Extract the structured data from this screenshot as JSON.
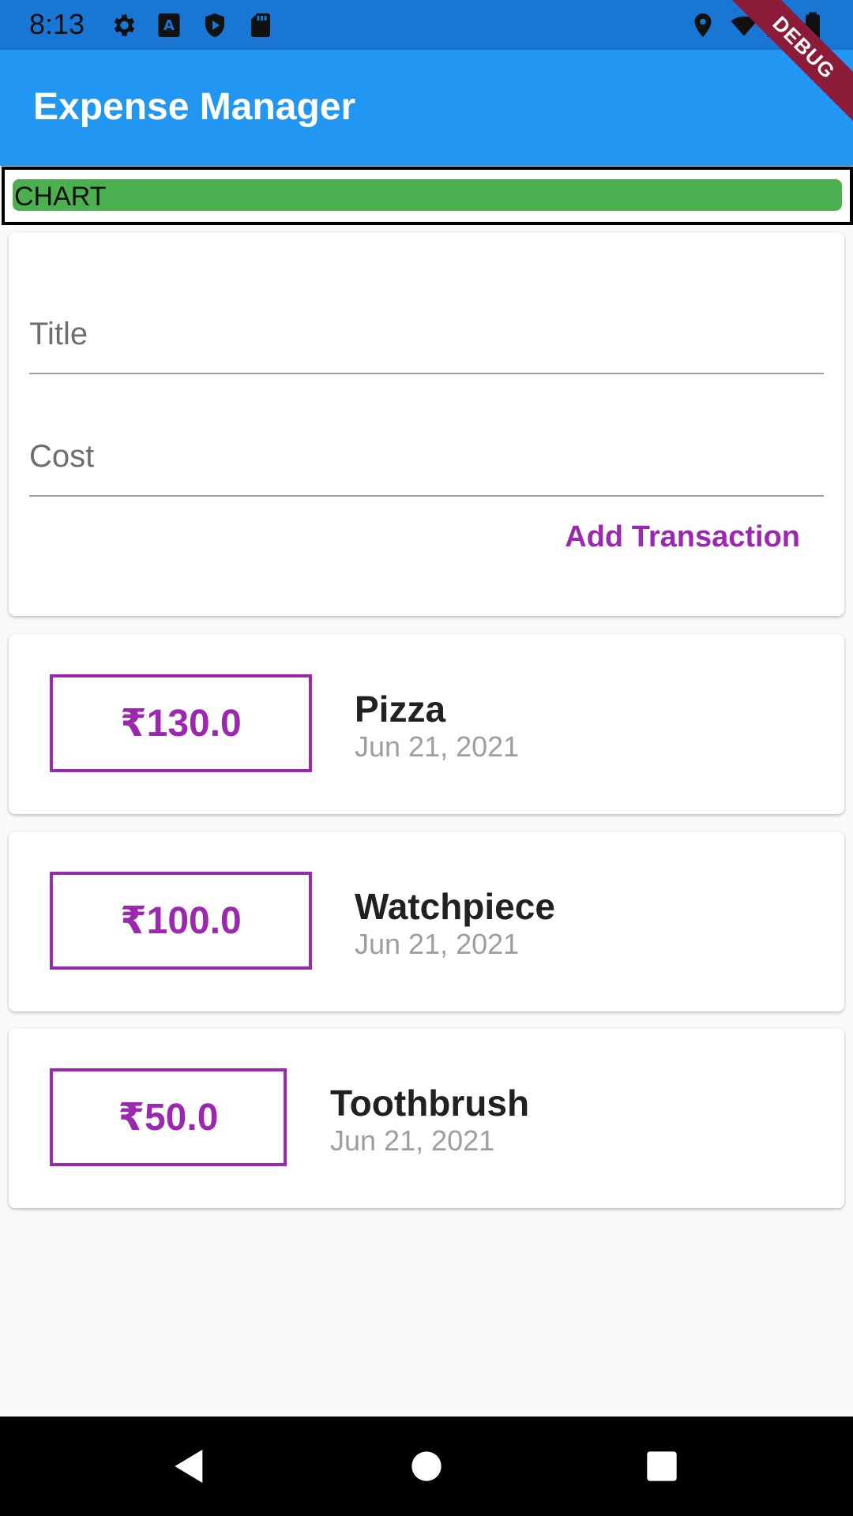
{
  "status_bar": {
    "time": "8:13",
    "left_icons": [
      "gear-icon",
      "a-icon",
      "shield-icon",
      "sd-card-icon"
    ],
    "right_icons": [
      "location-icon",
      "wifi-icon",
      "signal-icon",
      "battery-icon"
    ]
  },
  "app_bar": {
    "title": "Expense Manager",
    "color": "#2196f3"
  },
  "debug_banner": "DEBUG",
  "chart": {
    "label": "CHART",
    "bar_color": "#4caf50"
  },
  "form": {
    "title_placeholder": "Title",
    "cost_placeholder": "Cost",
    "add_button_label": "Add Transaction",
    "accent_color": "#9c27b0"
  },
  "transactions": [
    {
      "amount": "₹130.0",
      "title": "Pizza",
      "date": "Jun 21, 2021"
    },
    {
      "amount": "₹100.0",
      "title": "Watchpiece",
      "date": "Jun 21, 2021"
    },
    {
      "amount": "₹50.0",
      "title": "Toothbrush",
      "date": "Jun 21, 2021"
    }
  ],
  "nav_bar": {
    "buttons": [
      "back-icon",
      "home-icon",
      "recents-icon"
    ]
  }
}
